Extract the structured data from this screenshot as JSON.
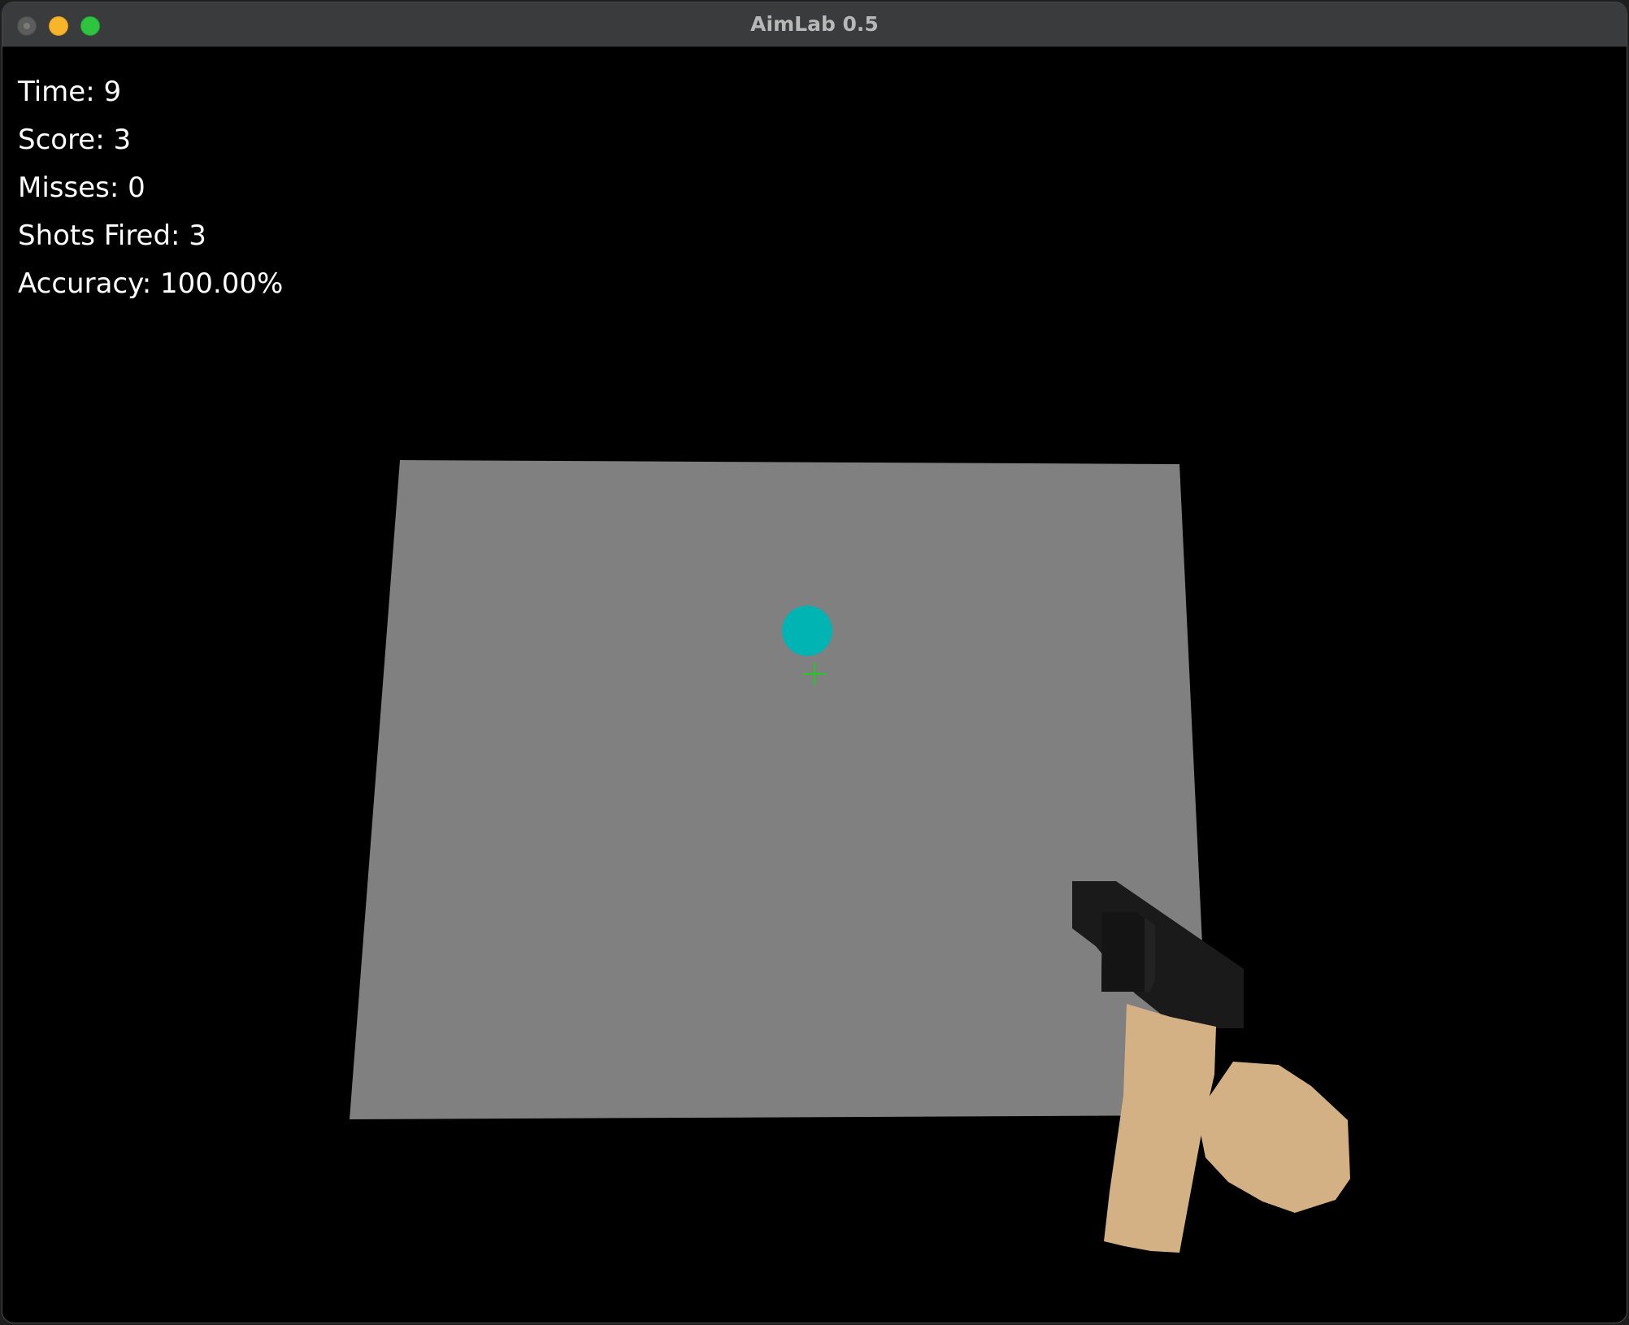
{
  "window": {
    "title": "AimLab 0.5"
  },
  "hud": {
    "time": "Time: 9",
    "score": "Score: 3",
    "misses": "Misses: 0",
    "shots_fired": "Shots Fired: 3",
    "accuracy": "Accuracy: 100.00%"
  },
  "scene": {
    "background_color": "#000000",
    "wall_color": "#808080",
    "target_color": "#00b4b4",
    "crosshair_color": "#22c922",
    "gun_color": "#1a1a1a",
    "hand_color": "#d4b184",
    "icons": [
      "close-icon",
      "minimize-icon",
      "zoom-icon",
      "crosshair-icon"
    ]
  }
}
